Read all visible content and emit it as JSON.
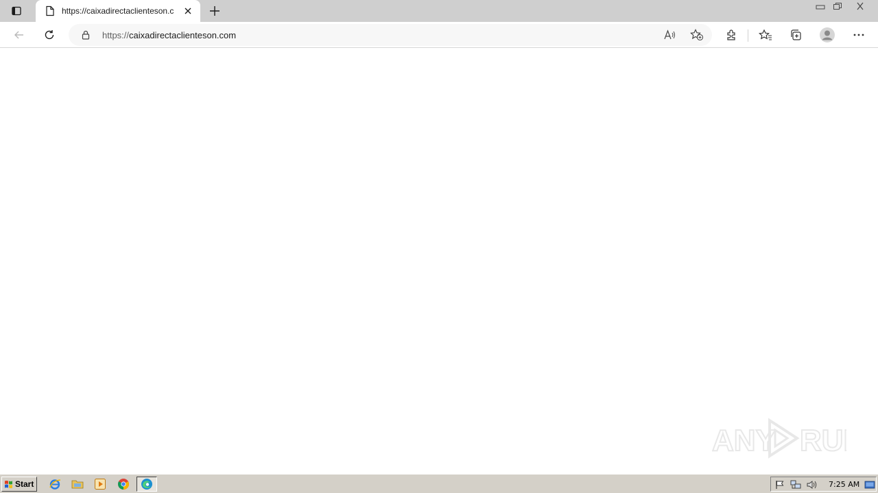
{
  "browser": {
    "tab": {
      "title": "https://caixadirectaclienteson.c"
    },
    "address_bar": {
      "url_prefix": "https://",
      "url_domain": "caixadirectaclienteson.com"
    }
  },
  "watermark": {
    "text": "ANY RUN"
  },
  "taskbar": {
    "start_label": "Start",
    "clock": "7:25 AM"
  },
  "icons": {
    "tab_actions": "tab-actions-icon",
    "page": "page-icon",
    "close": "close-icon",
    "new_tab": "plus-icon",
    "back": "back-arrow-icon",
    "refresh": "refresh-icon",
    "lock": "lock-icon",
    "read_aloud": "read-aloud-icon",
    "add_favorite": "add-favorite-icon",
    "extensions": "extensions-icon",
    "favorites": "favorites-icon",
    "collections": "collections-icon",
    "profile": "profile-icon",
    "more": "more-icon"
  }
}
